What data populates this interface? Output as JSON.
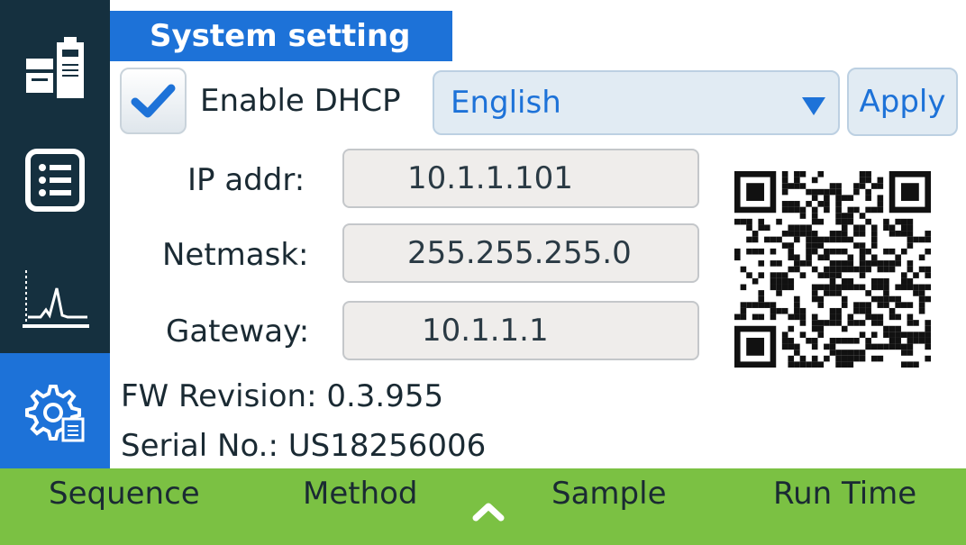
{
  "header": {
    "title": "System setting"
  },
  "dhcp": {
    "checked": true,
    "label": "Enable DHCP"
  },
  "language": {
    "selected": "English"
  },
  "apply_label": "Apply",
  "network": {
    "ip_label": "IP addr:",
    "ip_value": "10.1.1.101",
    "netmask_label": "Netmask:",
    "netmask_value": "255.255.255.0",
    "gateway_label": "Gateway:",
    "gateway_value": "10.1.1.1"
  },
  "info": {
    "fw": "FW Revision: 0.3.955",
    "serial": "Serial No.: US18256006"
  },
  "sidebar": {
    "items": [
      {
        "icon": "instrument-icon"
      },
      {
        "icon": "list-icon"
      },
      {
        "icon": "chromatogram-icon"
      },
      {
        "icon": "settings-icon",
        "active": true
      }
    ]
  },
  "bottom_tabs": {
    "sequence": "Sequence",
    "method": "Method",
    "sample": "Sample",
    "run_time": "Run Time"
  },
  "colors": {
    "accent": "#1d72d8",
    "sidebar": "#15303f",
    "bottom_bar": "#7bc143"
  }
}
